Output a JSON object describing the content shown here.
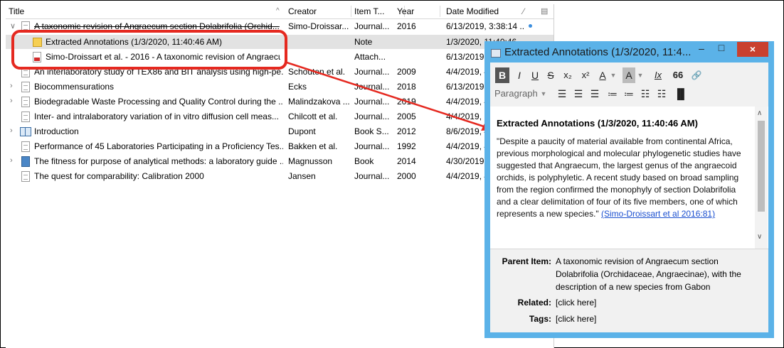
{
  "columns": {
    "title": "Title",
    "creator": "Creator",
    "item_type": "Item T...",
    "year": "Year",
    "date_modified": "Date Modified"
  },
  "rows": [
    {
      "title": "A taxonomic revision of Angraecum section Dolabrifolia (Orchid...",
      "creator": "Simo-Droissar...",
      "type": "Journal...",
      "year": "2016",
      "date": "6/13/2019, 3:38:14 ..."
    },
    {
      "title": "Extracted Annotations (1/3/2020, 11:40:46 AM)",
      "creator": "",
      "type": "Note",
      "year": "",
      "date": "1/3/2020, 11:40:46"
    },
    {
      "title": "Simo-Droissart et al. - 2016 - A taxonomic revision of Angraecu...",
      "creator": "",
      "type": "Attach...",
      "year": "",
      "date": "6/13/2019,"
    },
    {
      "title": "An interlaboratory study of TEX86 and BIT analysis using high-pe...",
      "creator": "Schouten et al.",
      "type": "Journal...",
      "year": "2009",
      "date": "4/4/2019, 4"
    },
    {
      "title": "Biocommensurations",
      "creator": "Ecks",
      "type": "Journal...",
      "year": "2018",
      "date": "6/13/2019,"
    },
    {
      "title": "Biodegradable Waste Processing and Quality Control during the ...",
      "creator": "Malindzakova ...",
      "type": "Journal...",
      "year": "2019",
      "date": "4/4/2019, 4"
    },
    {
      "title": "Inter- and intralaboratory variation of in vitro diffusion cell meas...",
      "creator": "Chilcott et al.",
      "type": "Journal...",
      "year": "2005",
      "date": "4/4/2019,"
    },
    {
      "title": "Introduction",
      "creator": "Dupont",
      "type": "Book S...",
      "year": "2012",
      "date": "8/6/2019, 4"
    },
    {
      "title": "Performance of 45 Laboratories Participating in a Proficiency Tes...",
      "creator": "Bakken et al.",
      "type": "Journal...",
      "year": "1992",
      "date": "4/4/2019, 4"
    },
    {
      "title": "The fitness for purpose of analytical methods: a laboratory guide ...",
      "creator": "Magnusson",
      "type": "Book",
      "year": "2014",
      "date": "4/30/2019,"
    },
    {
      "title": "The quest for comparability: Calibration 2000",
      "creator": "Jansen",
      "type": "Journal...",
      "year": "2000",
      "date": "4/4/2019, 4"
    }
  ],
  "note_window": {
    "title": "Extracted Annotations (1/3/2020, 11:4...",
    "toolbar": {
      "bold": "B",
      "italic": "I",
      "underline": "U",
      "strike": "S",
      "subscript": "x₂",
      "superscript": "x²",
      "text_color": "A",
      "highlight": "A",
      "clear_format": "Ix",
      "quote": "66",
      "link": "🔗",
      "paragraph": "Paragraph"
    },
    "heading": "Extracted Annotations (1/3/2020, 11:40:46 AM)",
    "body": "\"Despite a paucity of material available from continental Africa, previous morphological and molecular phylogenetic studies have suggested that Angraecum, the largest genus of the angraecoid orchids, is polyphyletic. A recent study based on broad sampling from the region confirmed the monophyly of section Dolabrifolia and a clear delimitation of four of its five members, one of which represents a new species.\"",
    "citation": "(Simo-Droissart et al 2016:81)",
    "parent_label": "Parent Item:",
    "parent_value": "A taxonomic revision of Angraecum section Dolabrifolia (Orchidaceae, Angraecinae), with the description of a new species from Gabon",
    "related_label": "Related:",
    "related_value": "[click here]",
    "tags_label": "Tags:",
    "tags_value": "[click here]"
  },
  "colors": {
    "annotation_red": "#e52920",
    "window_frame": "#5bb2e8",
    "close_button": "#c9402f",
    "selected_row": "#e2e2e2"
  }
}
